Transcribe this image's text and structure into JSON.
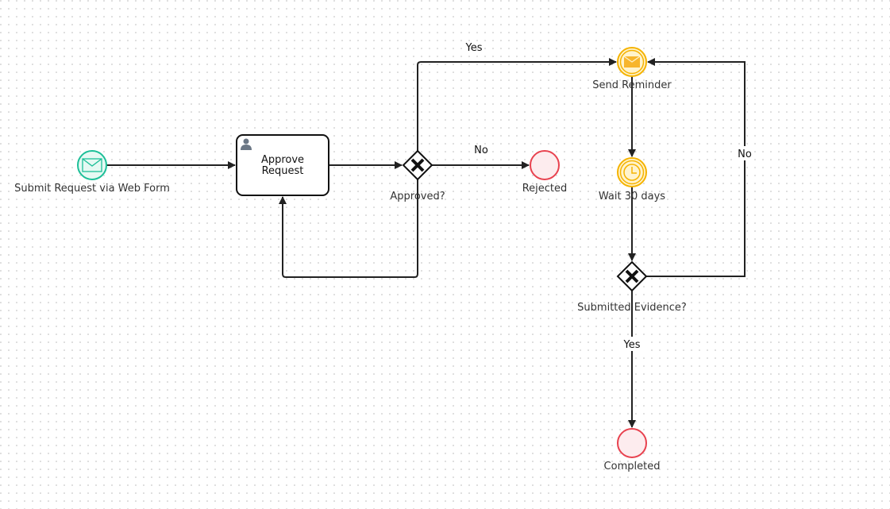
{
  "colors": {
    "start": "#1dbf98",
    "end": "#e8424f",
    "intermediate": "#f5b301",
    "line": "#222222"
  },
  "nodes": {
    "start": {
      "label": "Submit Request via Web Form",
      "icon": "envelope-icon"
    },
    "task": {
      "line1": "Approve",
      "line2": "Request",
      "icon": "user-icon"
    },
    "gateway1": {
      "label": "Approved?",
      "icon": "x-icon"
    },
    "rejected": {
      "label": "Rejected"
    },
    "send_reminder": {
      "label": "Send Reminder",
      "icon": "envelope-icon"
    },
    "wait": {
      "label": "Wait 30 days",
      "icon": "clock-icon"
    },
    "gateway2": {
      "label": "Submitted Evidence?",
      "icon": "x-icon"
    },
    "completed": {
      "label": "Completed"
    }
  },
  "flows": {
    "approved_yes": "Yes",
    "approved_no": "No",
    "evidence_no": "No",
    "evidence_yes": "Yes"
  }
}
